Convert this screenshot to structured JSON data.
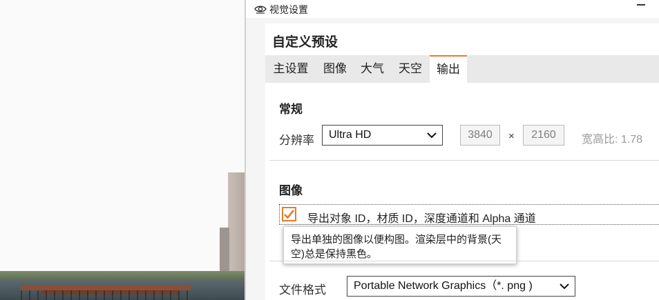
{
  "window": {
    "title": "视觉设置",
    "icon": "eye-icon"
  },
  "panel": {
    "heading": "自定义预设",
    "tabs": [
      {
        "label": "主设置",
        "active": false
      },
      {
        "label": "图像",
        "active": false
      },
      {
        "label": "大气",
        "active": false
      },
      {
        "label": "天空",
        "active": false
      },
      {
        "label": "输出",
        "active": true
      }
    ]
  },
  "general": {
    "title": "常规",
    "resolution_label": "分辨率",
    "resolution_value": "Ultra HD",
    "width": "3840",
    "times": "×",
    "height": "2160",
    "aspect_ratio": "宽高比: 1.78"
  },
  "image": {
    "title": "图像",
    "export_checkbox_label": "导出对象 ID，材质 ID，深度通道和 Alpha 通道",
    "export_checked": true,
    "tooltip": "导出单独的图像以便构图。渲染层中的背景(天空)总是保持黑色。",
    "file_format_label": "文件格式",
    "file_format_value": "Portable Network Graphics（*. png )"
  },
  "colors": {
    "accent": "#e87a2a",
    "panel_bg": "#f5f5f5",
    "tabbar_bg": "#e9e9e9"
  }
}
